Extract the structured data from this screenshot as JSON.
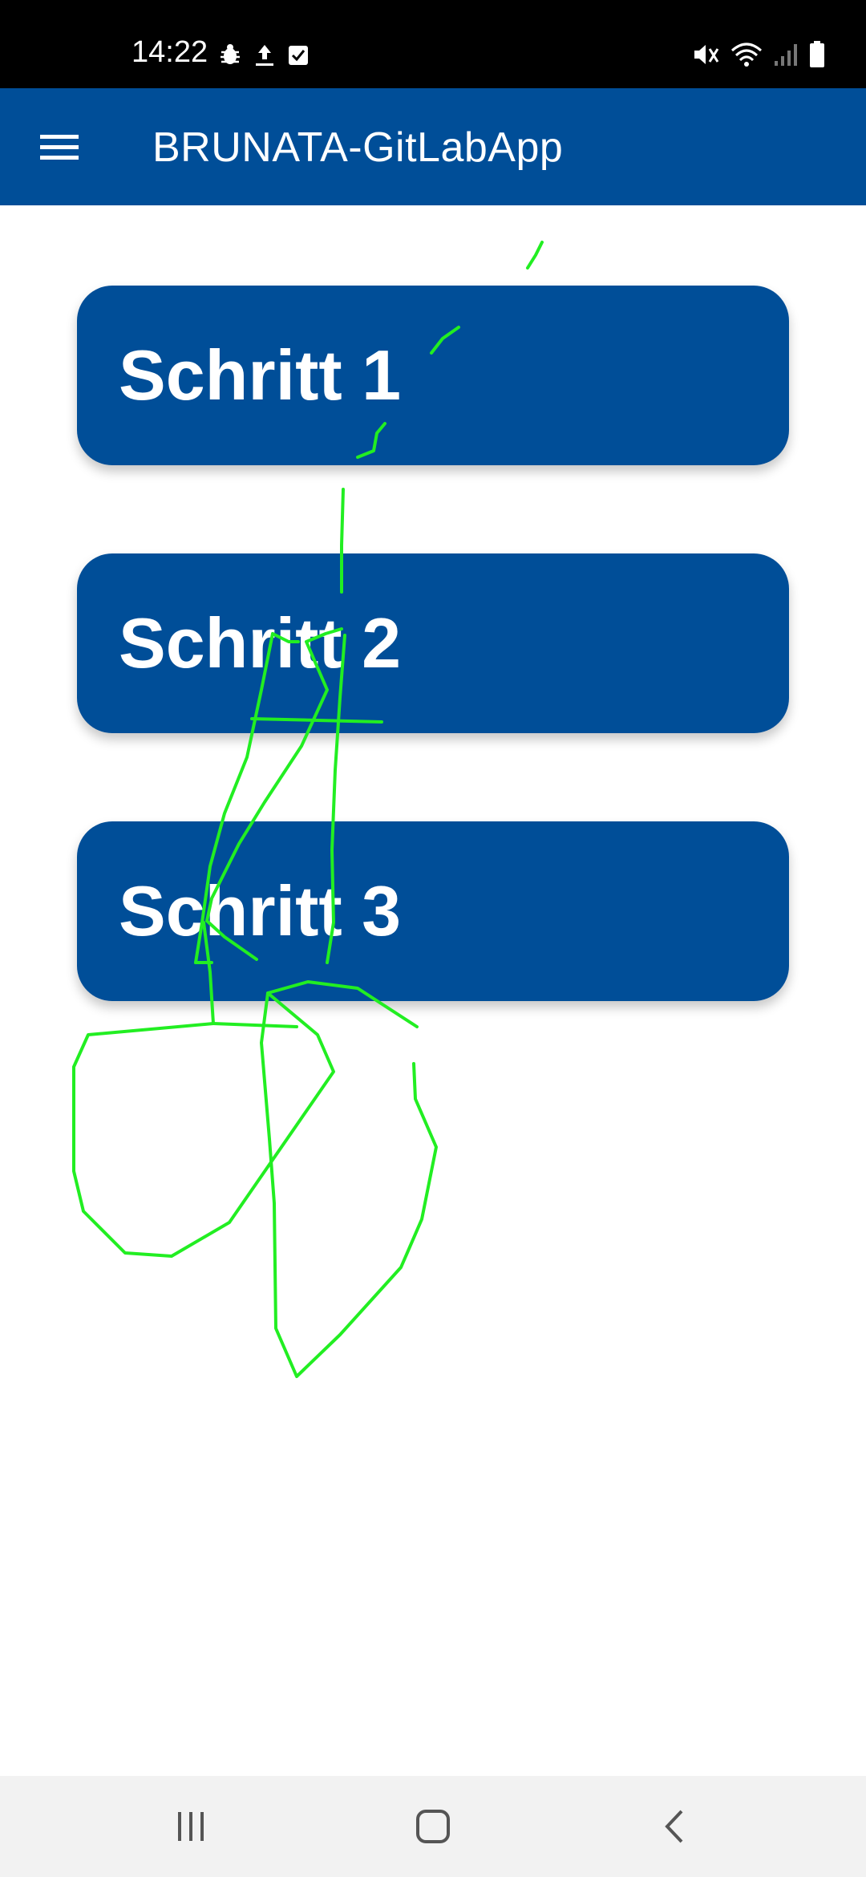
{
  "status_bar": {
    "time": "14:22",
    "left_icons": [
      "bug-icon",
      "upload-icon",
      "checkbox-icon"
    ],
    "right_icons": [
      "mute-icon",
      "wifi-icon",
      "signal-icon",
      "battery-icon"
    ]
  },
  "app_bar": {
    "menu_icon": "hamburger-menu-icon",
    "title": "BRUNATA-GitLabApp",
    "color": "#004e98"
  },
  "steps": [
    {
      "label": "Schritt 1"
    },
    {
      "label": "Schritt 2"
    },
    {
      "label": "Schritt 3"
    }
  ],
  "overlay": {
    "type": "freehand-drawing",
    "color": "#22ee22"
  },
  "nav_bar": {
    "buttons": [
      "recents-icon",
      "home-icon",
      "back-icon"
    ]
  }
}
